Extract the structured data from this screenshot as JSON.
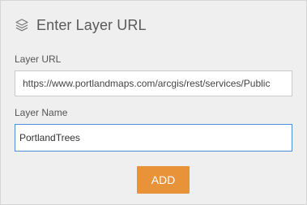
{
  "header": {
    "icon": "layers-icon",
    "title": "Enter Layer URL"
  },
  "form": {
    "url_label": "Layer URL",
    "url_value": "https://www.portlandmaps.com/arcgis/rest/services/Public",
    "name_label": "Layer Name",
    "name_value": "PortlandTrees"
  },
  "actions": {
    "add_label": "ADD"
  },
  "colors": {
    "accent": "#e8933a",
    "panel_background": "#efefef",
    "focus_border": "#4a90d9"
  }
}
